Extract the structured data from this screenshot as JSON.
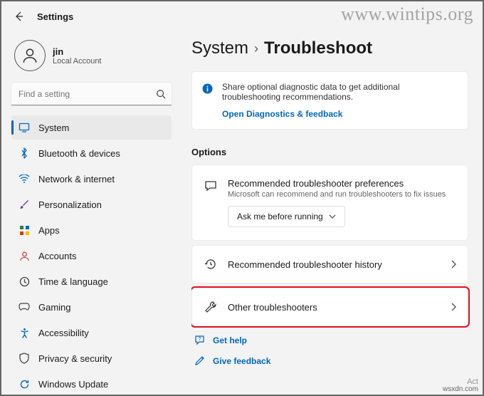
{
  "watermark": "www.wintips.org",
  "attribution": "wsxdn.com",
  "activation_hint": "Act",
  "app_title": "Settings",
  "user": {
    "name": "jin",
    "subtitle": "Local Account"
  },
  "search": {
    "placeholder": "Find a setting"
  },
  "sidebar": {
    "items": [
      {
        "label": "System",
        "color": "#0067c0",
        "active": true
      },
      {
        "label": "Bluetooth & devices",
        "color": "#0067c0"
      },
      {
        "label": "Network & internet",
        "color": "#0067c0"
      },
      {
        "label": "Personalization",
        "color": "#6b3fa0"
      },
      {
        "label": "Apps",
        "color": "#2d7d46"
      },
      {
        "label": "Accounts",
        "color": "#c05050"
      },
      {
        "label": "Time & language",
        "color": "#444"
      },
      {
        "label": "Gaming",
        "color": "#444"
      },
      {
        "label": "Accessibility",
        "color": "#0067c0"
      },
      {
        "label": "Privacy & security",
        "color": "#444"
      },
      {
        "label": "Windows Update",
        "color": "#0067c0"
      }
    ]
  },
  "breadcrumb": {
    "parent": "System",
    "current": "Troubleshoot"
  },
  "banner": {
    "text": "Share optional diagnostic data to get additional troubleshooting recommendations.",
    "link": "Open Diagnostics & feedback"
  },
  "options_label": "Options",
  "pref": {
    "title": "Recommended troubleshooter preferences",
    "subtitle": "Microsoft can recommend and run troubleshooters to fix issues",
    "dropdown_value": "Ask me before running"
  },
  "rows": {
    "history": "Recommended troubleshooter history",
    "other": "Other troubleshooters"
  },
  "help": {
    "get_help": "Get help",
    "feedback": "Give feedback"
  }
}
